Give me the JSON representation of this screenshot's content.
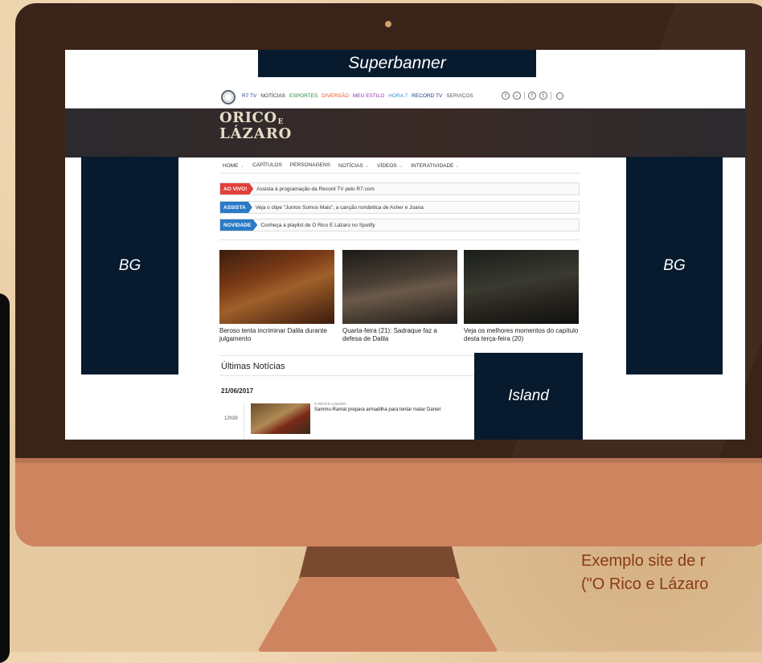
{
  "ads": {
    "superbanner": "Superbanner",
    "bg_left": "BG",
    "bg_right": "BG",
    "island": "Island"
  },
  "site": {
    "top_nav": [
      {
        "label": "R7 TV",
        "color": "#2a3a9a"
      },
      {
        "label": "NOTÍCIAS",
        "color": "#333333"
      },
      {
        "label": "ESPORTES",
        "color": "#2a8a3a"
      },
      {
        "label": "DIVERSÃO",
        "color": "#e8542a"
      },
      {
        "label": "MEU ESTILO",
        "color": "#8a3aa8"
      },
      {
        "label": "HORA 7",
        "color": "#2a9ac8"
      },
      {
        "label": "RECORD TV",
        "color": "#1a3a8a"
      },
      {
        "label": "SERVIÇOS",
        "color": "#555555"
      }
    ],
    "social_icons": [
      "f",
      "✓",
      "f",
      "t"
    ],
    "show_logo": {
      "line1": "ORICO",
      "small_e": "E",
      "line2": "LÁZARO"
    },
    "section_nav": [
      {
        "label": "HOME",
        "has_dropdown": true
      },
      {
        "label": "CAPÍTULOS",
        "has_dropdown": false
      },
      {
        "label": "PERSONAGENS",
        "has_dropdown": false
      },
      {
        "label": "NOTÍCIAS",
        "has_dropdown": true
      },
      {
        "label": "VÍDEOS",
        "has_dropdown": true
      },
      {
        "label": "INTERATIVIDADE",
        "has_dropdown": true
      }
    ],
    "alerts": [
      {
        "tag": "AO VIVO!",
        "text": "Assista à programação da Record TV pelo R7.com",
        "color": "#e2403a"
      },
      {
        "tag": "ASSISTA",
        "text": "Veja o clipe \"Juntos Somos Mais\", a canção romântica de Asher e Joana",
        "color": "#2a7ac8"
      },
      {
        "tag": "NOVIDADE",
        "text": "Conheça a playlist de O Rico E Lázaro no Spotify",
        "color": "#2a7ac8"
      }
    ],
    "cards": [
      {
        "caption": "Beroso tenta incriminar Dalila durante julgamento"
      },
      {
        "caption": "Quarta-feira (21): Sadraque faz a defesa de Dalila"
      },
      {
        "caption": "Veja os melhores momentos do capítulo desta terça-feira (20)"
      }
    ],
    "latest": {
      "title": "Últimas Notícias",
      "date": "21/06/2017",
      "items": [
        {
          "time": "12h39",
          "kicker": "O RICO E LÁZARO",
          "headline": "Sammu-Ramat prepara armadilha para tentar matar Daniel"
        }
      ]
    }
  },
  "caption": {
    "line1": "Exemplo site de r",
    "line2": "(\"O Rico e Lázaro"
  }
}
